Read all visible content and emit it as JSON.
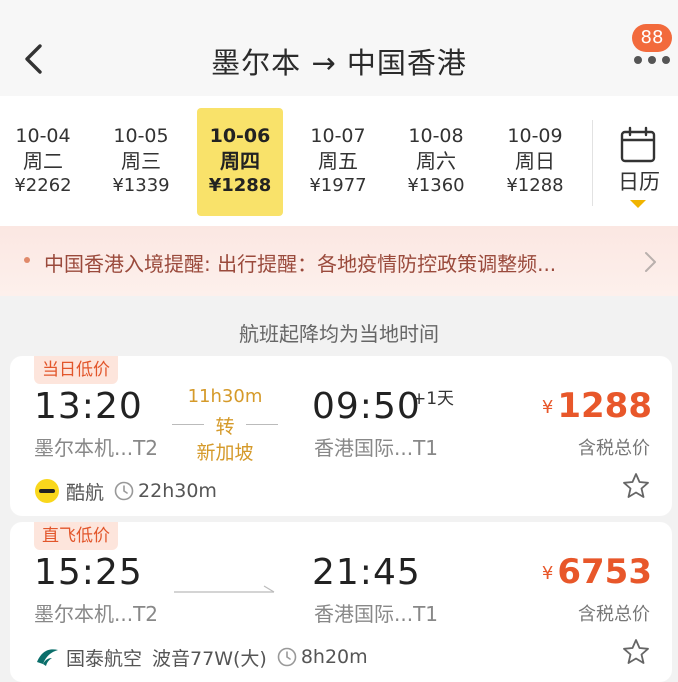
{
  "header": {
    "title": "墨尔本 → 中国香港",
    "badge_count": "88"
  },
  "dates": [
    {
      "date": "10-04",
      "weekday": "周二",
      "price": "¥2262",
      "active": false
    },
    {
      "date": "10-05",
      "weekday": "周三",
      "price": "¥1339",
      "active": false
    },
    {
      "date": "10-06",
      "weekday": "周四",
      "price": "¥1288",
      "active": true
    },
    {
      "date": "10-07",
      "weekday": "周五",
      "price": "¥1977",
      "active": false
    },
    {
      "date": "10-08",
      "weekday": "周六",
      "price": "¥1360",
      "active": false
    },
    {
      "date": "10-09",
      "weekday": "周日",
      "price": "¥1288",
      "active": false
    }
  ],
  "calendar": {
    "label": "日历"
  },
  "notice": {
    "text": "中国香港入境提醒: 出行提醒：各地疫情防控政策调整频..."
  },
  "tz_note": "航班起降均为当地时间",
  "flights": [
    {
      "tag": "当日低价",
      "dep_time": "13:20",
      "dep_airport": "墨尔本机...T2",
      "duration": "11h30m",
      "stop_label": "转",
      "stop_city": "新加坡",
      "arr_time": "09:50",
      "arr_plus": "+1天",
      "arr_airport": "香港国际...T1",
      "currency": "¥",
      "price": "1288",
      "tax_label": "含税总价",
      "airline": "酷航",
      "aircraft": "",
      "total_duration": "22h30m"
    },
    {
      "tag": "直飞低价",
      "dep_time": "15:25",
      "dep_airport": "墨尔本机...T2",
      "arr_time": "21:45",
      "arr_airport": "香港国际...T1",
      "currency": "¥",
      "price": "6753",
      "tax_label": "含税总价",
      "airline": "国泰航空",
      "aircraft": "波音77W(大)",
      "total_duration": "8h20m"
    }
  ],
  "colors": {
    "accent": "#e8572a",
    "selected_date": "#f9e26a",
    "stop_info": "#d59a2a"
  }
}
